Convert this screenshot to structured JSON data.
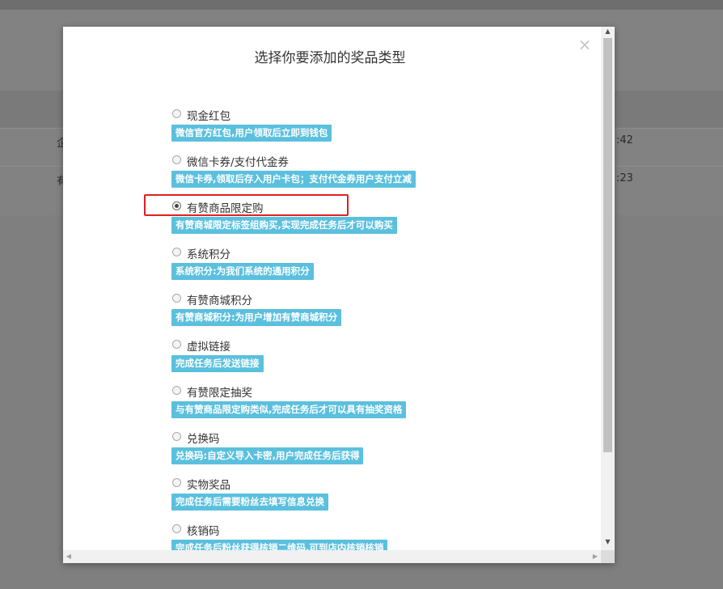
{
  "background": {
    "rows": [
      {
        "left": "企",
        "right": ":42"
      },
      {
        "left": "有",
        "right": ":23"
      }
    ]
  },
  "modal": {
    "title": "选择你要添加的奖品类型",
    "close_icon": "×",
    "selected_option": "有赞商品限定购",
    "options": [
      {
        "label": "现金红包",
        "desc": "微信官方红包,用户领取后立即到钱包",
        "checked": false
      },
      {
        "label": "微信卡券/支付代金券",
        "desc": "微信卡券,领取后存入用户卡包；支付代金券用户支付立减",
        "checked": false
      },
      {
        "label": "有赞商品限定购",
        "desc": "有赞商城限定标签组购买,实现完成任务后才可以购买",
        "checked": true
      },
      {
        "label": "系统积分",
        "desc": "系统积分:为我们系统的通用积分",
        "checked": false
      },
      {
        "label": "有赞商城积分",
        "desc": "有赞商城积分:为用户增加有赞商城积分",
        "checked": false
      },
      {
        "label": "虚拟链接",
        "desc": "完成任务后发送链接",
        "checked": false
      },
      {
        "label": "有赞限定抽奖",
        "desc": "与有赞商品限定购类似,完成任务后才可以具有抽奖资格",
        "checked": false
      },
      {
        "label": "兑换码",
        "desc": "兑换码:自定义导入卡密,用户完成任务后获得",
        "checked": false
      },
      {
        "label": "实物奖品",
        "desc": "完成任务后需要粉丝去填写信息兑换",
        "checked": false
      },
      {
        "label": "核销码",
        "desc": "完成任务后粉丝获得核销二维码,可到店内核销核销",
        "checked": false
      }
    ]
  },
  "scrollbars": {
    "up_arrow": "▲",
    "down_arrow": "▼",
    "left_arrow": "◀",
    "right_arrow": "▶"
  }
}
